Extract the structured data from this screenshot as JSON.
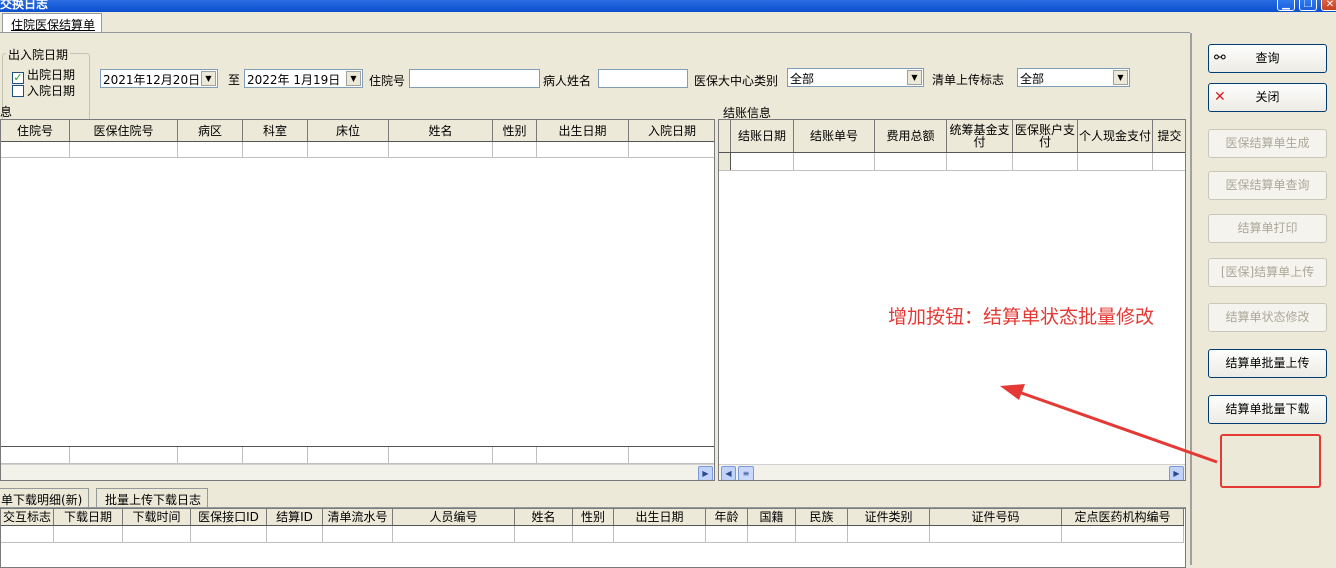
{
  "window": {
    "title": "交换日志"
  },
  "tabs": {
    "main": "住院医保结算单"
  },
  "search": {
    "group_title": "出入院日期",
    "opt_discharge": "出院日期",
    "opt_admission": "入院日期",
    "opt_discharge_checked": true,
    "opt_admission_checked": false,
    "date_from": "2021年12月20日",
    "to_label": "至",
    "date_to": "2022年 1月19日",
    "inpatient_no_label": "住院号",
    "patient_name_label": "病人姓名",
    "center_type_label": "医保大中心类别",
    "center_type_value": "全部",
    "upload_flag_label": "清单上传标志",
    "upload_flag_value": "全部"
  },
  "left_grid": {
    "title": "息",
    "columns": [
      "住院号",
      "医保住院号",
      "病区",
      "科室",
      "床位",
      "姓名",
      "性别",
      "出生日期",
      "入院日期"
    ]
  },
  "settle_grid": {
    "title": "结账信息",
    "columns": [
      "结账日期",
      "结账单号",
      "费用总额",
      "统筹基金支付",
      "医保账户支付",
      "个人现金支付",
      "提交"
    ]
  },
  "bottom_tabs": {
    "tab1": "单下载明细(新)",
    "tab2": "批量上传下载日志"
  },
  "bottom_grid": {
    "columns": [
      "交互标志",
      "下载日期",
      "下载时间",
      "医保接口ID",
      "结算ID",
      "清单流水号",
      "人员编号",
      "姓名",
      "性别",
      "出生日期",
      "年龄",
      "国籍",
      "民族",
      "证件类别",
      "证件号码",
      "定点医药机构编号"
    ]
  },
  "buttons": {
    "query": "查询",
    "close": "关闭",
    "gen": "医保结算单生成",
    "view": "医保结算单查询",
    "print": "结算单打印",
    "upload": "[医保]结算单上传",
    "status": "结算单状态修改",
    "batch_upload": "结算单批量上传",
    "batch_download": "结算单批量下载"
  },
  "annotation": {
    "text": "增加按钮：结算单状态批量修改",
    "color": "#e53935"
  }
}
